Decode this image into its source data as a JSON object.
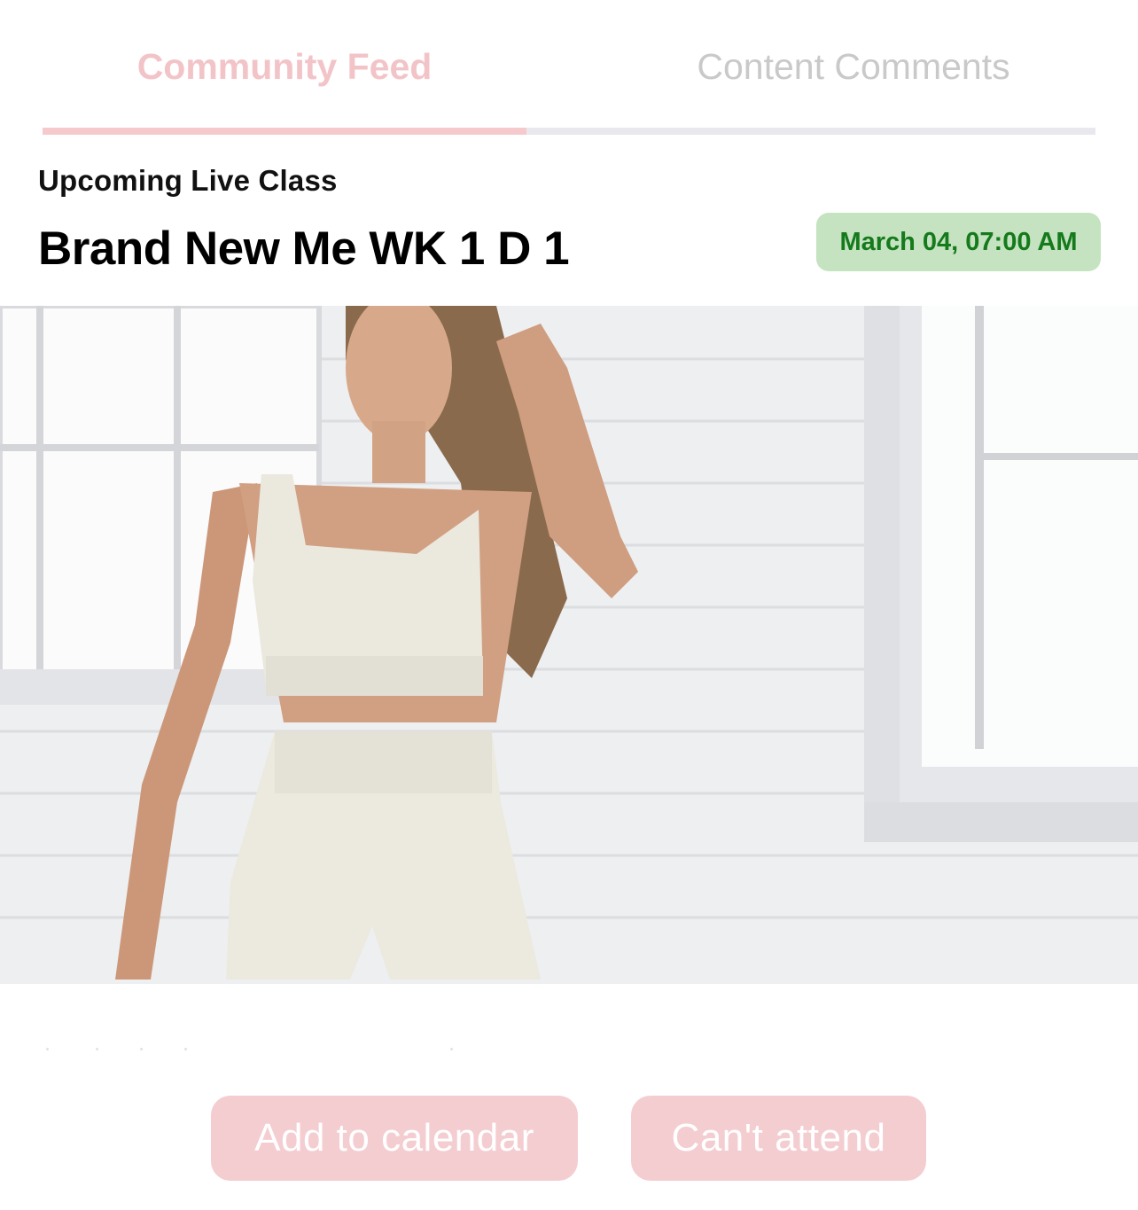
{
  "tabs": [
    {
      "label": "Community Feed",
      "active": true
    },
    {
      "label": "Content Comments",
      "active": false
    }
  ],
  "live_class": {
    "eyebrow": "Upcoming Live Class",
    "title": "Brand New Me WK 1 D 1",
    "datetime": "March 04, 07:00 AM"
  },
  "hero": {
    "icon": "class-photo"
  },
  "actions": {
    "add_to_calendar": "Add to calendar",
    "cant_attend": "Can't attend"
  },
  "colors": {
    "accent_pink": "#f6c9cd",
    "badge_bg": "#c5e3c0",
    "badge_text": "#157a1c"
  }
}
